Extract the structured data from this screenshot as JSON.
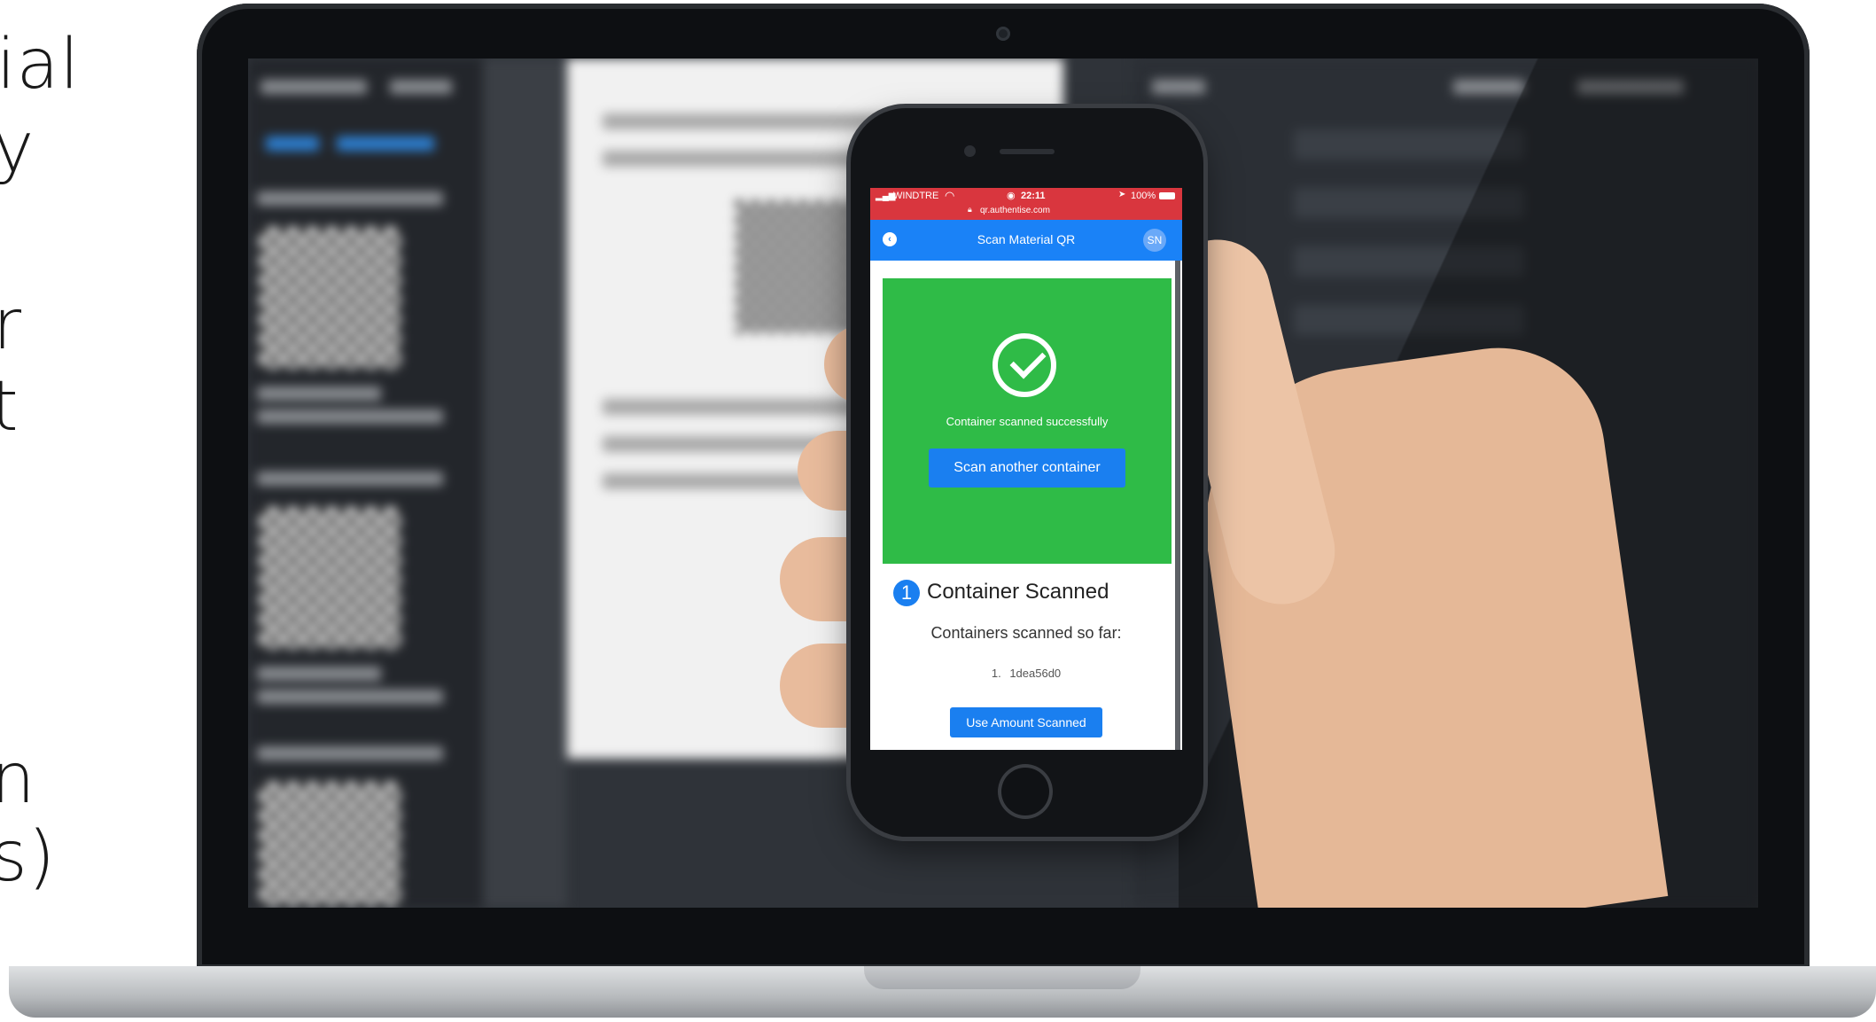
{
  "slide": {
    "fragments": [
      "ial",
      "y",
      "r",
      "t",
      "n",
      "s)"
    ]
  },
  "phone": {
    "status": {
      "carrier": "WINDTRE",
      "time": "22:11",
      "battery": "100%",
      "url": "qr.authentise.com"
    },
    "header": {
      "title": "Scan Material QR",
      "user_initials": "SN"
    },
    "success": {
      "message": "Container scanned successfully",
      "button_label": "Scan another container"
    },
    "summary": {
      "count": "1",
      "heading": "Container Scanned",
      "subheading": "Containers scanned so far:",
      "items": [
        {
          "index": "1.",
          "id": "1dea56d0"
        }
      ],
      "use_button_label": "Use Amount Scanned"
    }
  },
  "colors": {
    "status_bar": "#d9363e",
    "nav_bar": "#1a82f7",
    "success_green": "#2fbb47",
    "button_blue": "#1a7ff0"
  },
  "icons": [
    "wifi-icon",
    "signal-icon",
    "clock-icon",
    "battery-icon",
    "lock-icon",
    "location-icon",
    "back-icon",
    "checkmark-icon"
  ]
}
